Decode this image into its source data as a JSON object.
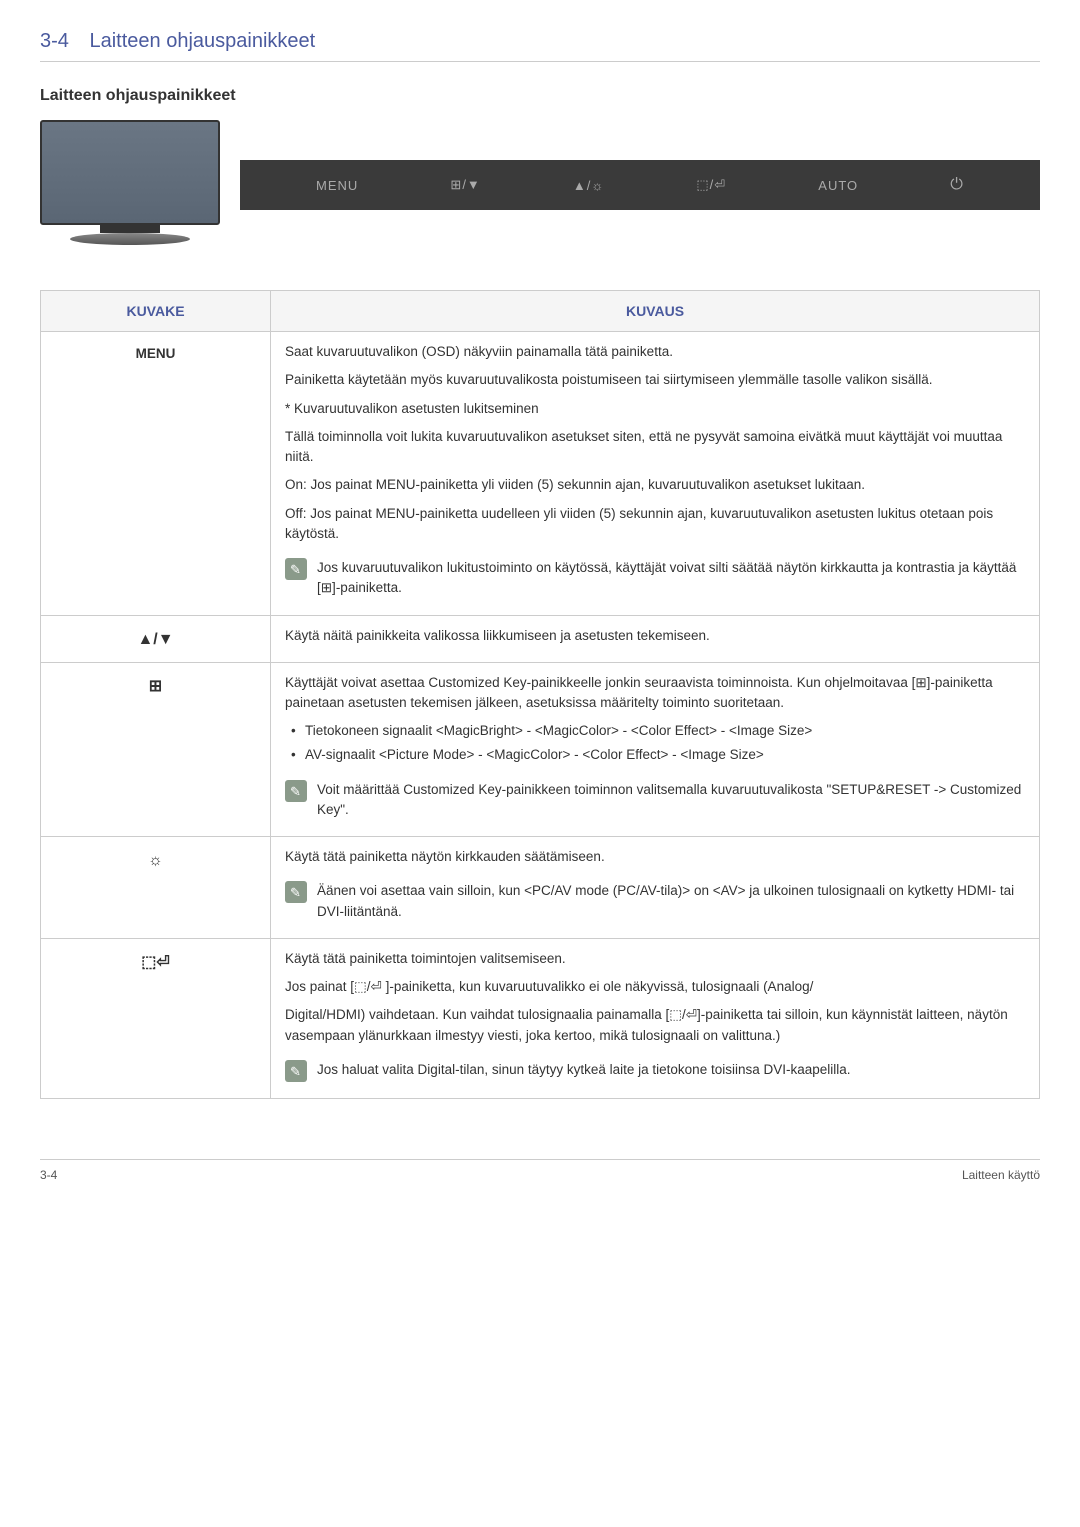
{
  "header": {
    "number": "3-4",
    "title": "Laitteen ohjauspainikkeet"
  },
  "subsection_title": "Laitteen ohjauspainikkeet",
  "button_bar": {
    "menu": "MENU",
    "custom": "⊞/▼",
    "bright": "▲/☼",
    "source": "⬚/⏎",
    "auto": "AUTO",
    "power": "⏻"
  },
  "table": {
    "headers": {
      "kuvake": "KUVAKE",
      "kuvaus": "KUVAUS"
    },
    "rows": [
      {
        "kuvake": "MENU",
        "kuvaus": {
          "p1": "Saat kuvaruutuvalikon (OSD) näkyviin painamalla tätä painiketta.",
          "p2": "Painiketta käytetään myös kuvaruutuvalikosta poistumiseen tai siirtymiseen ylemmälle tasolle valikon sisällä.",
          "p3": "* Kuvaruutuvalikon asetusten lukitseminen",
          "p4": "Tällä toiminnolla voit lukita kuvaruutuvalikon asetukset siten, että ne pysyvät samoina eivätkä muut käyttäjät voi muuttaa niitä.",
          "p5": "On: Jos painat MENU-painiketta yli viiden (5) sekunnin ajan, kuvaruutuvalikon asetukset lukitaan.",
          "p6": "Off: Jos painat MENU-painiketta uudelleen yli viiden (5) sekunnin ajan, kuvaruutuvalikon asetusten lukitus otetaan pois käytöstä.",
          "note": "Jos kuvaruutuvalikon lukitustoiminto on käytössä, käyttäjät voivat silti säätää näytön kirkkautta ja kontrastia ja käyttää [⊞]-painiketta."
        }
      },
      {
        "kuvake": "▲/▼",
        "kuvaus": {
          "p1": "Käytä näitä painikkeita valikossa liikkumiseen ja asetusten tekemiseen."
        }
      },
      {
        "kuvake": "⊞",
        "kuvaus": {
          "p1": "Käyttäjät voivat asettaa Customized Key-painikkeelle jonkin seuraavista toiminnoista. Kun ohjelmoitavaa [⊞]-painiketta painetaan asetusten tekemisen jälkeen, asetuksissa määritelty toiminto suoritetaan.",
          "b1": "Tietokoneen signaalit <MagicBright> - <MagicColor> - <Color Effect> - <Image Size>",
          "b2": "AV-signaalit <Picture Mode> - <MagicColor> - <Color Effect> - <Image Size>",
          "note": "Voit määrittää Customized Key-painikkeen toiminnon valitsemalla kuvaruutuvalikosta \"SETUP&RESET -> Customized Key\"."
        }
      },
      {
        "kuvake": "☼",
        "kuvaus": {
          "p1": "Käytä tätä painiketta näytön kirkkauden säätämiseen.",
          "note": "Äänen voi asettaa vain silloin, kun <PC/AV mode (PC/AV-tila)> on <AV> ja ulkoinen tulosignaali on kytketty HDMI- tai DVI-liitäntänä."
        }
      },
      {
        "kuvake": "⬚⏎",
        "kuvaus": {
          "p1": "Käytä tätä painiketta toimintojen valitsemiseen.",
          "p2": "Jos painat [⬚/⏎ ]-painiketta, kun kuvaruutuvalikko ei ole näkyvissä, tulosignaali (Analog/",
          "p3": "Digital/HDMI) vaihdetaan. Kun vaihdat tulosignaalia painamalla [⬚/⏎]-painiketta tai silloin, kun käynnistät laitteen, näytön vasempaan ylänurkkaan ilmestyy viesti, joka kertoo, mikä tulosignaali on valittuna.)",
          "note": "Jos haluat valita Digital-tilan, sinun täytyy kytkeä laite ja tietokone toisiinsa DVI-kaapelilla."
        }
      }
    ]
  },
  "footer": {
    "left": "3-4",
    "right": "Laitteen käyttö"
  }
}
